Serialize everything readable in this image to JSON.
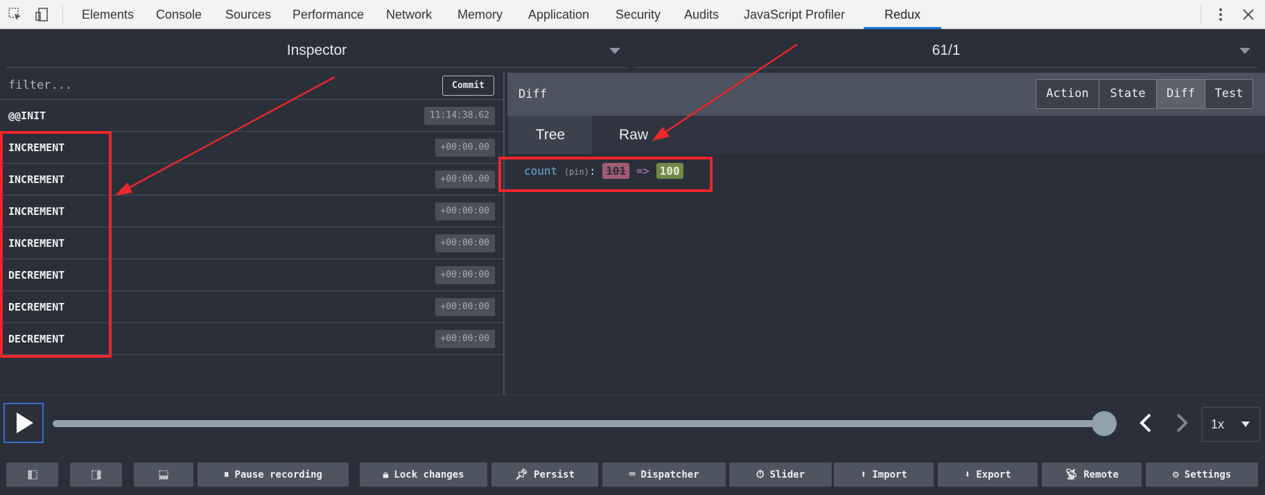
{
  "devtools": {
    "tabs": [
      "Elements",
      "Console",
      "Sources",
      "Performance",
      "Network",
      "Memory",
      "Application",
      "Security",
      "Audits",
      "JavaScript Profiler",
      "Redux"
    ],
    "active_tab": "Redux"
  },
  "header": {
    "monitor_select": "Inspector",
    "instance_select": "61/1"
  },
  "actions_list": {
    "filter_placeholder": "filter...",
    "commit_label": "Commit",
    "items": [
      {
        "name": "@@INIT",
        "time": "11:14:38.62"
      },
      {
        "name": "INCREMENT",
        "time": "+00:00.00"
      },
      {
        "name": "INCREMENT",
        "time": "+00:00.00"
      },
      {
        "name": "INCREMENT",
        "time": "+00:00:00"
      },
      {
        "name": "INCREMENT",
        "time": "+00:00:00"
      },
      {
        "name": "DECREMENT",
        "time": "+00:00:00"
      },
      {
        "name": "DECREMENT",
        "time": "+00:00:00"
      },
      {
        "name": "DECREMENT",
        "time": "+00:00:00"
      }
    ]
  },
  "inspector": {
    "title": "Diff",
    "tabs": [
      "Action",
      "State",
      "Diff",
      "Test"
    ],
    "active_tab": "Diff",
    "subtabs": [
      "Tree",
      "Raw"
    ],
    "active_subtab": "Tree",
    "diff": {
      "key": "count",
      "pin": "(pin)",
      "colon": ":",
      "old_value": "101",
      "arrow": "=>",
      "new_value": "100"
    }
  },
  "slider": {
    "position": 1.0,
    "speed": "1x"
  },
  "bottom_buttons": [
    {
      "label": "",
      "icon": "dock-left-icon"
    },
    {
      "label": "",
      "icon": "dock-right-icon"
    },
    {
      "label": "",
      "icon": "dock-bottom-icon"
    },
    {
      "label": "Pause recording",
      "icon": "pause-icon"
    },
    {
      "label": "Lock changes",
      "icon": "lock-icon"
    },
    {
      "label": "Persist",
      "icon": "pin-icon"
    },
    {
      "label": "Dispatcher",
      "icon": "keyboard-icon"
    },
    {
      "label": "Slider",
      "icon": "timer-icon"
    },
    {
      "label": "Import",
      "icon": "upload-icon"
    },
    {
      "label": "Export",
      "icon": "download-icon"
    },
    {
      "label": "Remote",
      "icon": "remote-icon"
    },
    {
      "label": "Settings",
      "icon": "gear-icon"
    }
  ],
  "colors": {
    "background": "#2a2f3a",
    "annotation_red": "#f0262a",
    "diff_removed": "#a15c73",
    "diff_added": "#6f8a4a",
    "active_devtools_tab": "#1a73e8"
  }
}
